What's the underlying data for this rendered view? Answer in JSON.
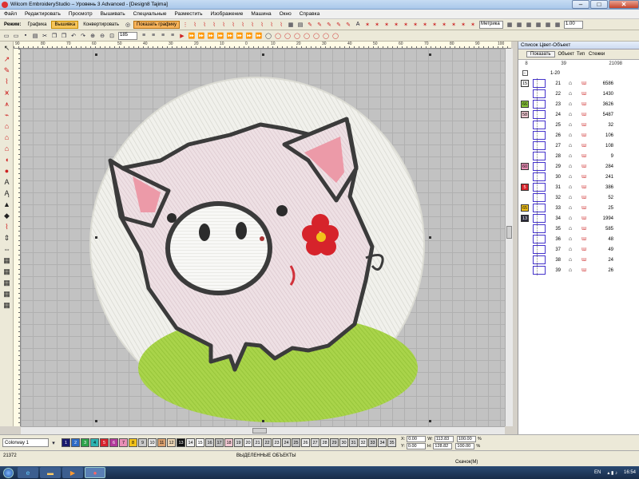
{
  "window": {
    "title": "Wilcom EmbroideryStudio – Уровень 3 Advanced - [Design8          Tajima]",
    "buttons": {
      "minimize": "–",
      "maximize": "□",
      "close": "✕"
    }
  },
  "menu": [
    "Файл",
    "Редактировать",
    "Просмотр",
    "Вышивать",
    "Специальные",
    "Разместить",
    "Изображение",
    "Машина",
    "Окно",
    "Справка"
  ],
  "toolbar": {
    "mode_label": "Режим:",
    "graphics_label": "Графика",
    "embroidery_label": "Вышивка",
    "convert_label": "Конвертировать",
    "show_graphics_label": "Показать графику",
    "zoom_value": "185",
    "units_value": "Метрика",
    "stitch_value": "1.00"
  },
  "ruler": {
    "top_labels": [
      "90",
      "80",
      "70",
      "60",
      "50",
      "40",
      "30",
      "20",
      "10",
      "0",
      "10",
      "20",
      "30",
      "40",
      "50",
      "60",
      "70",
      "80",
      "90",
      "100"
    ]
  },
  "right_panel": {
    "title": "Список Цвет-Объект",
    "show_button": "Показать",
    "header_cols": [
      "Объект",
      "Тип",
      "Стежки"
    ],
    "summary": {
      "a": "8",
      "b": "39",
      "c": "21098"
    },
    "group_label": "1-20",
    "rows": [
      {
        "badge": "15",
        "badge_color": "#ffffff",
        "idx": "21",
        "count": "6586"
      },
      {
        "badge": "",
        "badge_color": "",
        "idx": "22",
        "count": "1430"
      },
      {
        "badge": "66",
        "badge_color": "#8ac83a",
        "idx": "23",
        "count": "3626"
      },
      {
        "badge": "58",
        "badge_color": "#f3c9d3",
        "idx": "24",
        "count": "5487"
      },
      {
        "badge": "",
        "badge_color": "",
        "idx": "25",
        "count": "32"
      },
      {
        "badge": "",
        "badge_color": "",
        "idx": "26",
        "count": "106"
      },
      {
        "badge": "",
        "badge_color": "",
        "idx": "27",
        "count": "108"
      },
      {
        "badge": "",
        "badge_color": "",
        "idx": "28",
        "count": "9"
      },
      {
        "badge": "60",
        "badge_color": "#e98fb6",
        "idx": "29",
        "count": "284"
      },
      {
        "badge": "",
        "badge_color": "",
        "idx": "30",
        "count": "241"
      },
      {
        "badge": "5",
        "badge_color": "#d6232b",
        "idx": "31",
        "count": "386"
      },
      {
        "badge": "",
        "badge_color": "",
        "idx": "32",
        "count": "52"
      },
      {
        "badge": "65",
        "badge_color": "#f2c21a",
        "idx": "33",
        "count": "25"
      },
      {
        "badge": "13",
        "badge_color": "#2a2a3a",
        "idx": "34",
        "count": "1994"
      },
      {
        "badge": "",
        "badge_color": "",
        "idx": "35",
        "count": "585"
      },
      {
        "badge": "",
        "badge_color": "",
        "idx": "36",
        "count": "48"
      },
      {
        "badge": "",
        "badge_color": "",
        "idx": "37",
        "count": "49"
      },
      {
        "badge": "",
        "badge_color": "",
        "idx": "38",
        "count": "24"
      },
      {
        "badge": "",
        "badge_color": "",
        "idx": "39",
        "count": "26"
      }
    ]
  },
  "colorbar": {
    "colorway": "Colorway 1",
    "swatches": [
      {
        "n": "1",
        "c": "#1a1a6e"
      },
      {
        "n": "2",
        "c": "#2e6bc6"
      },
      {
        "n": "3",
        "c": "#2ea34a"
      },
      {
        "n": "4",
        "c": "#2bb3b0"
      },
      {
        "n": "5",
        "c": "#d6232b"
      },
      {
        "n": "6",
        "c": "#b23a9a"
      },
      {
        "n": "7",
        "c": "#e98fb6"
      },
      {
        "n": "8",
        "c": "#f2c21a"
      },
      {
        "n": "9",
        "c": "#c9c9c9"
      },
      {
        "n": "10",
        "c": "#e6e6e6"
      },
      {
        "n": "11",
        "c": "#d9a06e"
      },
      {
        "n": "12",
        "c": "#ecd6b5"
      },
      {
        "n": "13",
        "c": "#111111"
      },
      {
        "n": "14",
        "c": "#efefef"
      },
      {
        "n": "15",
        "c": "#ffffff"
      },
      {
        "n": "16",
        "c": "#cfcfcf"
      },
      {
        "n": "17",
        "c": "#bcbcbc"
      },
      {
        "n": "18",
        "c": "#f3c9d3"
      },
      {
        "n": "19",
        "c": "#d8d8d8"
      },
      {
        "n": "20",
        "c": "#eeeeee"
      },
      {
        "n": "21",
        "c": "#e1e1e1"
      },
      {
        "n": "22",
        "c": "#d2d2d2"
      },
      {
        "n": "23",
        "c": "#e5e5e5"
      },
      {
        "n": "24",
        "c": "#dadada"
      },
      {
        "n": "25",
        "c": "#c5c5c5"
      },
      {
        "n": "26",
        "c": "#eeeeee"
      },
      {
        "n": "27",
        "c": "#dcdcdc"
      },
      {
        "n": "28",
        "c": "#e9e9e9"
      },
      {
        "n": "29",
        "c": "#d0d0d0"
      },
      {
        "n": "30",
        "c": "#e2e2e2"
      },
      {
        "n": "31",
        "c": "#d6d6d6"
      },
      {
        "n": "32",
        "c": "#ececec"
      },
      {
        "n": "33",
        "c": "#cbcbcb"
      },
      {
        "n": "34",
        "c": "#e0e0e0"
      },
      {
        "n": "35",
        "c": "#dddddd"
      }
    ],
    "x_label": "X:",
    "x_value": "0.00",
    "y_label": "Y:",
    "y_value": "0.00",
    "w_label": "W:",
    "w_value": "113.83",
    "h_label": "H:",
    "h_value": "128.82",
    "sw_value": "100.00",
    "sh_value": "100.00",
    "pct": "%"
  },
  "status": {
    "count": "21372",
    "selected": "ВЫДЕЛЕННЫЕ ОБЪЕКТЫ",
    "sub": "Скачок(M)"
  },
  "tray": {
    "lang": "EN",
    "time": "16:54"
  }
}
